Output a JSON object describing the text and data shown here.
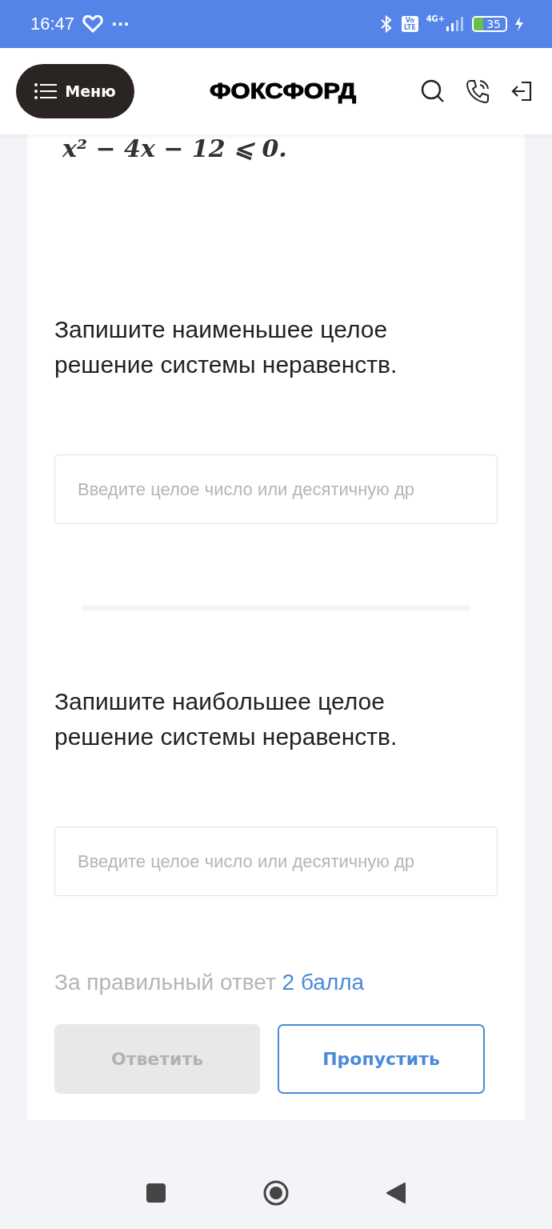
{
  "status_bar": {
    "time": "16:47",
    "dots": "···",
    "volte": [
      "Vo",
      "LTE"
    ],
    "network": "4G+",
    "battery": "35"
  },
  "header": {
    "menu_button": "Меню",
    "logo": "ФОКСФОРД"
  },
  "task": {
    "formula_cut": "x² − 4x − 12 ⩽ 0.",
    "questions": [
      {
        "text": "Запишите наименьшее целое решение системы неравенств.",
        "placeholder": "Введите целое число или десятичную др"
      },
      {
        "text": "Запишите наибольшее целое решение системы неравенств.",
        "placeholder": "Введите целое число или десятичную др"
      }
    ],
    "points": "За правильный ответ **2 балла**",
    "buttons": [
      {
        "label": "Ответить",
        "disabled": true
      },
      {
        "label": "Пропустить",
        "disabled": false
      }
    ]
  }
}
